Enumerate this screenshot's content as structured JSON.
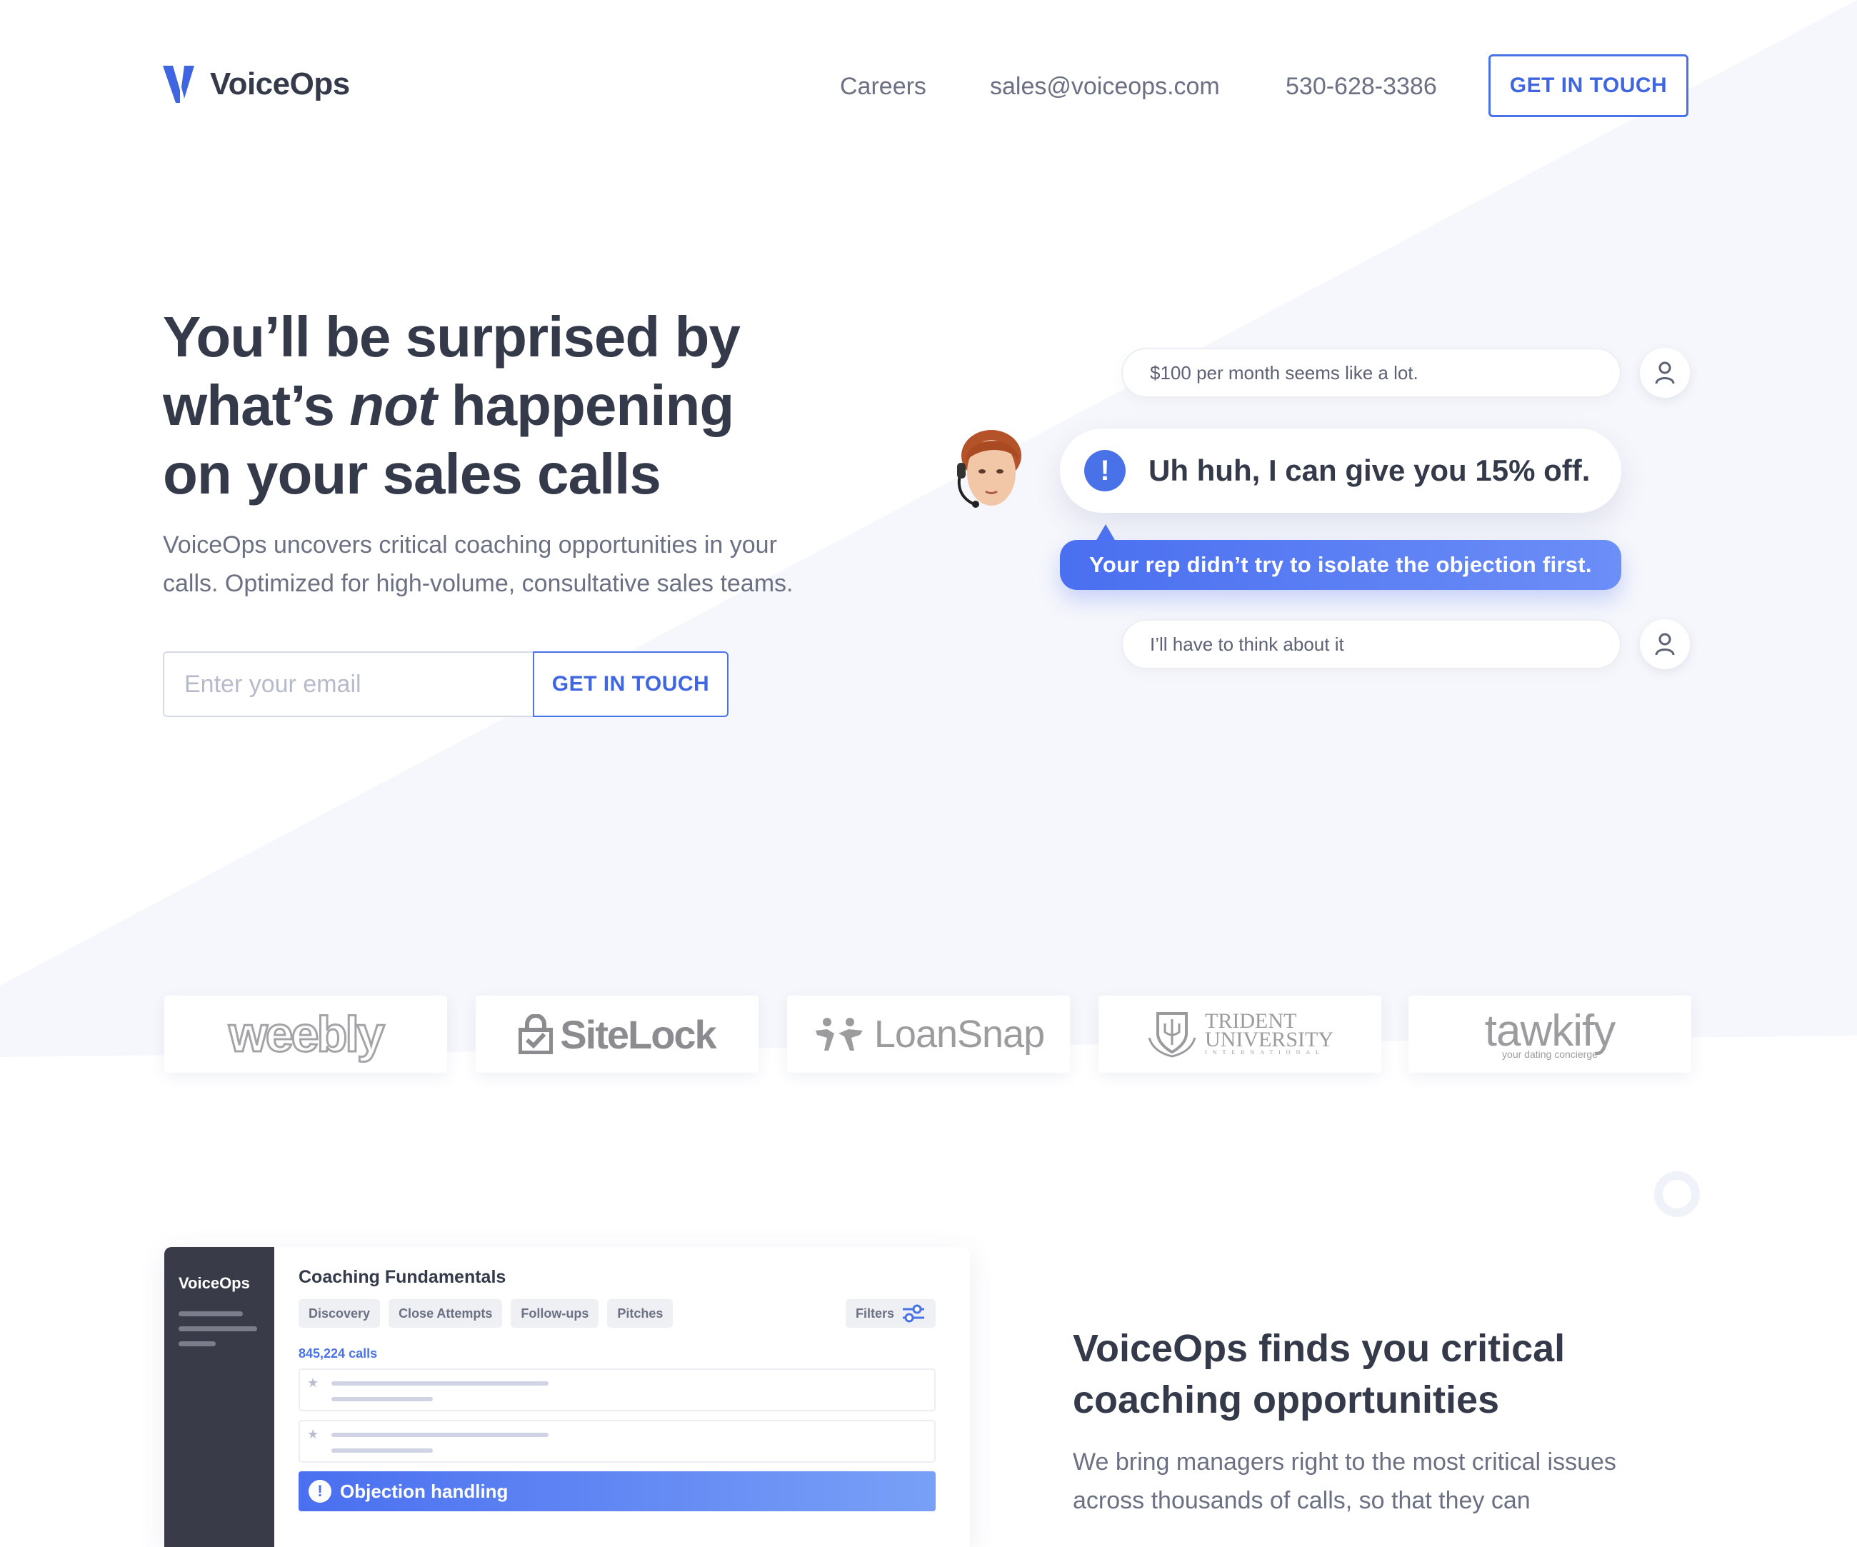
{
  "header": {
    "brand": "VoiceOps",
    "nav": {
      "careers": "Careers",
      "email": "sales@voiceops.com",
      "phone": "530-628-3386"
    },
    "cta": "GET IN TOUCH"
  },
  "hero": {
    "title_part1": "You’ll be surprised by what’s ",
    "title_emphasis": "not",
    "title_part2": " happening on your sales calls",
    "subtitle": "VoiceOps uncovers critical coaching opportunities in your calls. Optimized for high-volume, consultative sales teams.",
    "email_placeholder": "Enter your email",
    "cta": "GET IN TOUCH"
  },
  "conversation": {
    "customer_message_1": "$100 per month seems like a lot.",
    "rep_message": "Uh huh, I can give you 15% off.",
    "insight": "Your rep didn’t try to isolate the objection first.",
    "customer_message_2": "I’ll have to think about it",
    "alert_icon": "exclamation-icon",
    "customer_icon": "user-icon"
  },
  "clients": {
    "weebly": "weebly",
    "sitelock": "SiteLock",
    "loansnap": "LoanSnap",
    "trident_line1": "TRIDENT",
    "trident_line2": "UNIVERSITY",
    "trident_line3": "INTERNATIONAL",
    "tawkify": "tawkify",
    "tawkify_tagline": "your dating concierge"
  },
  "app_mock": {
    "sidebar_title": "VoiceOps",
    "title": "Coaching Fundamentals",
    "tags": [
      "Discovery",
      "Close Attempts",
      "Follow-ups",
      "Pitches"
    ],
    "filters_label": "Filters",
    "call_count": "845,224 calls",
    "highlight_label": "Objection handling"
  },
  "feature": {
    "title": "VoiceOps finds you critical coaching opportunities",
    "body": "We bring managers right to the most critical issues across thousands of calls, so that they can"
  },
  "colors": {
    "accent": "#4a72e8",
    "text_dark": "#353a4a",
    "text_muted": "#6b7083",
    "background_tint": "#f6f7fc"
  }
}
